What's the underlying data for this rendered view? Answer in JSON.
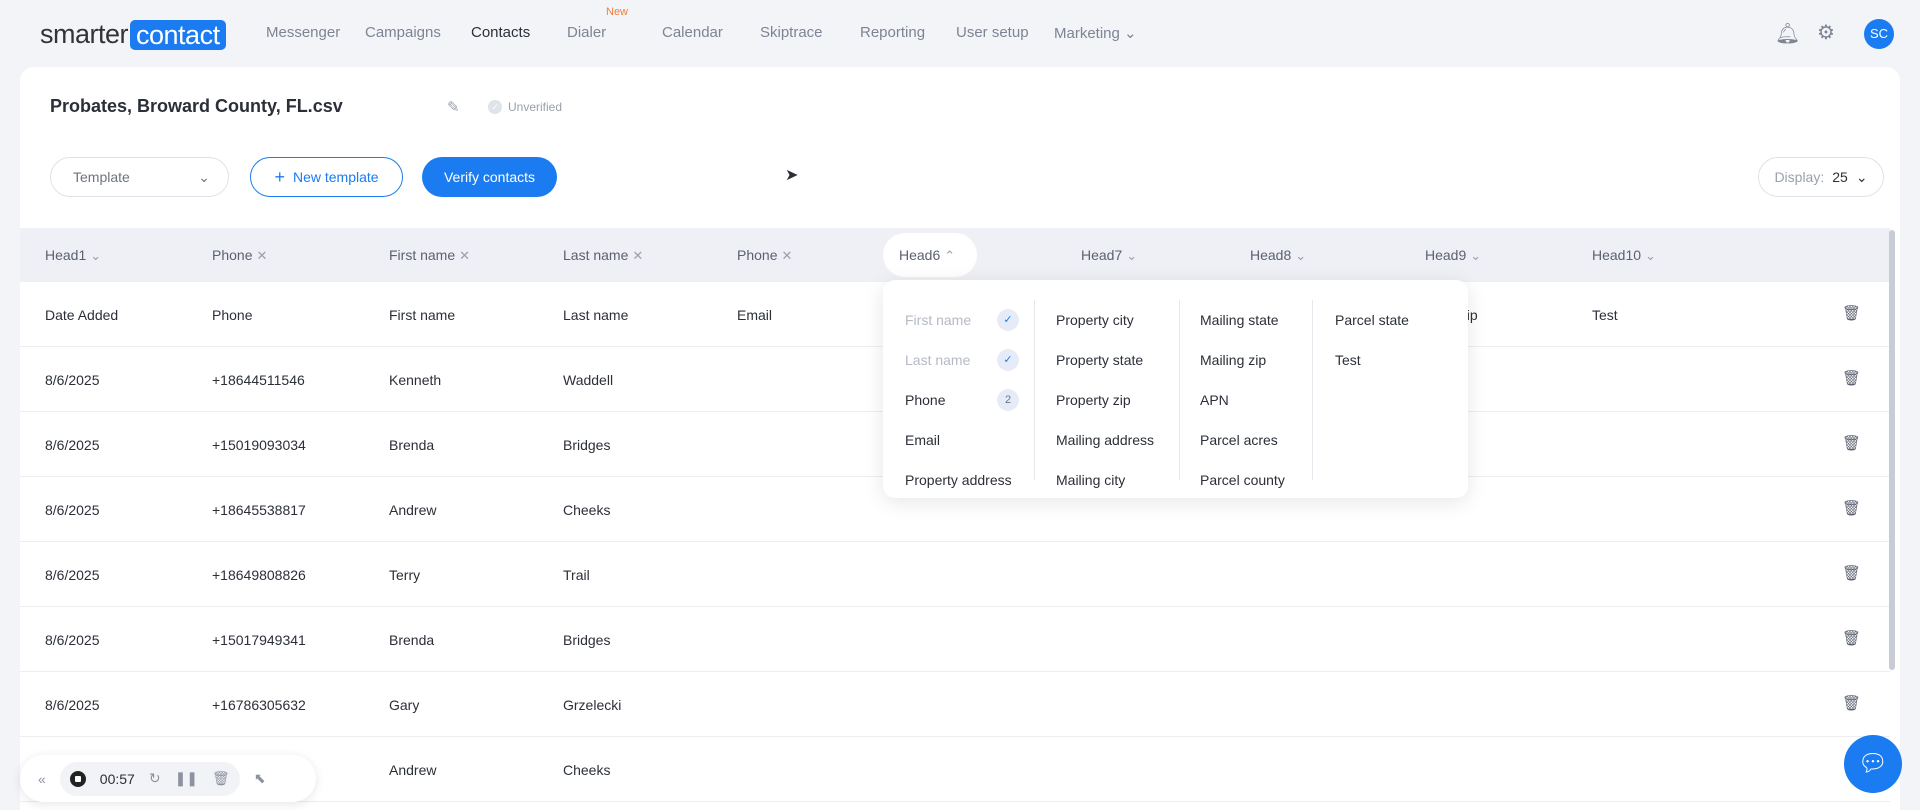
{
  "logo": {
    "part1": "smarter",
    "part2": "contact"
  },
  "nav": {
    "items": [
      "Messenger",
      "Campaigns",
      "Contacts",
      "Dialer",
      "Calendar",
      "Skiptrace",
      "Reporting",
      "User setup",
      "Marketing"
    ],
    "new_badge": "New",
    "avatar": "SC"
  },
  "file": {
    "title": "Probates, Broward County, FL.csv",
    "status": "Unverified"
  },
  "toolbar": {
    "template": "Template",
    "new_template": "New template",
    "verify": "Verify contacts",
    "display_label": "Display:",
    "display_value": "25"
  },
  "headers": [
    "Head1",
    "Phone",
    "First name",
    "Last name",
    "Phone",
    "Head6",
    "Head7",
    "Head8",
    "Head9",
    "Head10"
  ],
  "first_row": [
    "Date Added",
    "Phone",
    "First name",
    "Last name",
    "Email",
    "",
    "",
    "",
    "ty zip",
    "Test"
  ],
  "rows": [
    [
      "8/6/2025",
      "+18644511546",
      "Kenneth",
      "Waddell"
    ],
    [
      "8/6/2025",
      "+15019093034",
      "Brenda",
      "Bridges"
    ],
    [
      "8/6/2025",
      "+18645538817",
      "Andrew",
      "Cheeks"
    ],
    [
      "8/6/2025",
      "+18649808826",
      "Terry",
      "Trail"
    ],
    [
      "8/6/2025",
      "+15017949341",
      "Brenda",
      "Bridges"
    ],
    [
      "8/6/2025",
      "+16786305632",
      "Gary",
      "Grzelecki"
    ],
    [
      "",
      "",
      "Andrew",
      "Cheeks"
    ]
  ],
  "dropdown": {
    "col1": [
      {
        "label": "First name",
        "badge": "✓",
        "disabled": true
      },
      {
        "label": "Last name",
        "badge": "✓",
        "disabled": true
      },
      {
        "label": "Phone",
        "badge": "2"
      },
      {
        "label": "Email"
      },
      {
        "label": "Property address"
      }
    ],
    "col2": [
      "Property city",
      "Property state",
      "Property zip",
      "Mailing address",
      "Mailing city"
    ],
    "col3": [
      "Mailing state",
      "Mailing zip",
      "APN",
      "Parcel acres",
      "Parcel county"
    ],
    "col4": [
      "Parcel state",
      "Test"
    ]
  },
  "recorder": {
    "time": "00:57"
  }
}
